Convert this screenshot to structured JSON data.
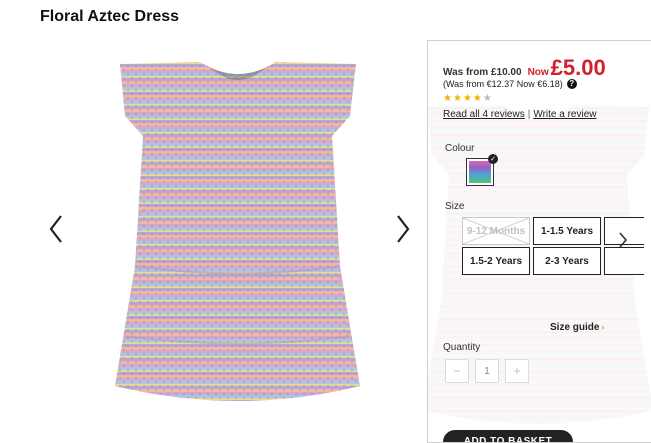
{
  "product": {
    "title": "Floral Aztec Dress"
  },
  "gallery": {
    "prev_icon": "chevron-left-icon",
    "next_icon": "chevron-right-icon"
  },
  "price": {
    "was": "Was from £10.00",
    "now_label": "Now",
    "now_price": "£5.00",
    "euro": "(Was from €12.37 Now €6.18)",
    "help_icon": "?"
  },
  "rating": {
    "stars_filled": 4,
    "stars_total": 5,
    "read_reviews": "Read all 4 reviews",
    "separator": "|",
    "write_review": "Write a review"
  },
  "colour": {
    "label": "Colour"
  },
  "size": {
    "label": "Size",
    "options": [
      {
        "label": "9-12 Months",
        "available": false
      },
      {
        "label": "1-1.5 Years",
        "available": true
      },
      {
        "label": "1.5-2 Years",
        "available": true
      },
      {
        "label": "2-3 Years",
        "available": true
      }
    ],
    "guide": "Size guide"
  },
  "quantity": {
    "label": "Quantity",
    "minus": "−",
    "value": "1",
    "plus": "+"
  },
  "basket": {
    "label": "ADD TO BASKET"
  },
  "colors": {
    "price_red": "#d0202a",
    "star": "#f0b400",
    "guide_arrow": "#f0a000"
  }
}
